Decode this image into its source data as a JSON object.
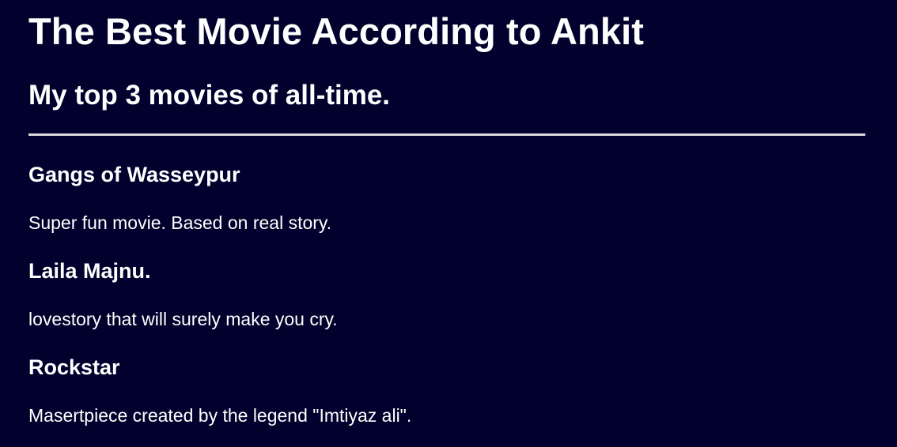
{
  "header": {
    "title": "The Best Movie According to Ankit",
    "subtitle": "My top 3 movies of all-time."
  },
  "movies": [
    {
      "title": "Gangs of Wasseypur",
      "description": "Super fun movie. Based on real story."
    },
    {
      "title": "Laila Majnu.",
      "description": "lovestory that will surely make you cry."
    },
    {
      "title": "Rockstar",
      "description": "Masertpiece created by the legend \"Imtiyaz ali\"."
    }
  ],
  "colors": {
    "background": "#02002c",
    "text": "#ffffff",
    "divider": "#d9d9d9"
  }
}
